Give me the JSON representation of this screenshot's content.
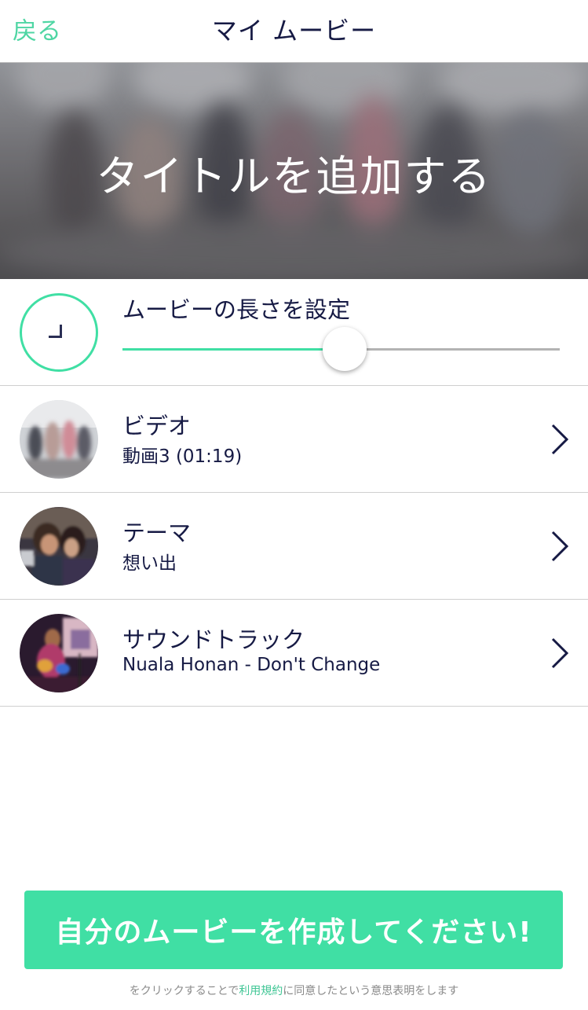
{
  "nav": {
    "back_label": "戻る",
    "title": "マイ ムービー"
  },
  "hero": {
    "title": "タイトルを追加する"
  },
  "length": {
    "label": "ムービーの長さを設定",
    "slider_fraction": 0.5
  },
  "items": [
    {
      "title": "ビデオ",
      "subtitle": "動画3 (01:19)",
      "icon": "video-thumbnail"
    },
    {
      "title": "テーマ",
      "subtitle": "想い出",
      "icon": "theme-thumbnail"
    },
    {
      "title": "サウンドトラック",
      "subtitle": "Nuala Honan - Don't Change",
      "icon": "soundtrack-thumbnail"
    }
  ],
  "cta": {
    "label": "自分のムービーを作成してください!"
  },
  "legal": {
    "prefix": "をクリックすることで",
    "link": "利用規約",
    "suffix": "に同意したという意思表明をします"
  },
  "colors": {
    "accent": "#40dfa4",
    "text": "#161a44",
    "back": "#4fd6a4"
  }
}
